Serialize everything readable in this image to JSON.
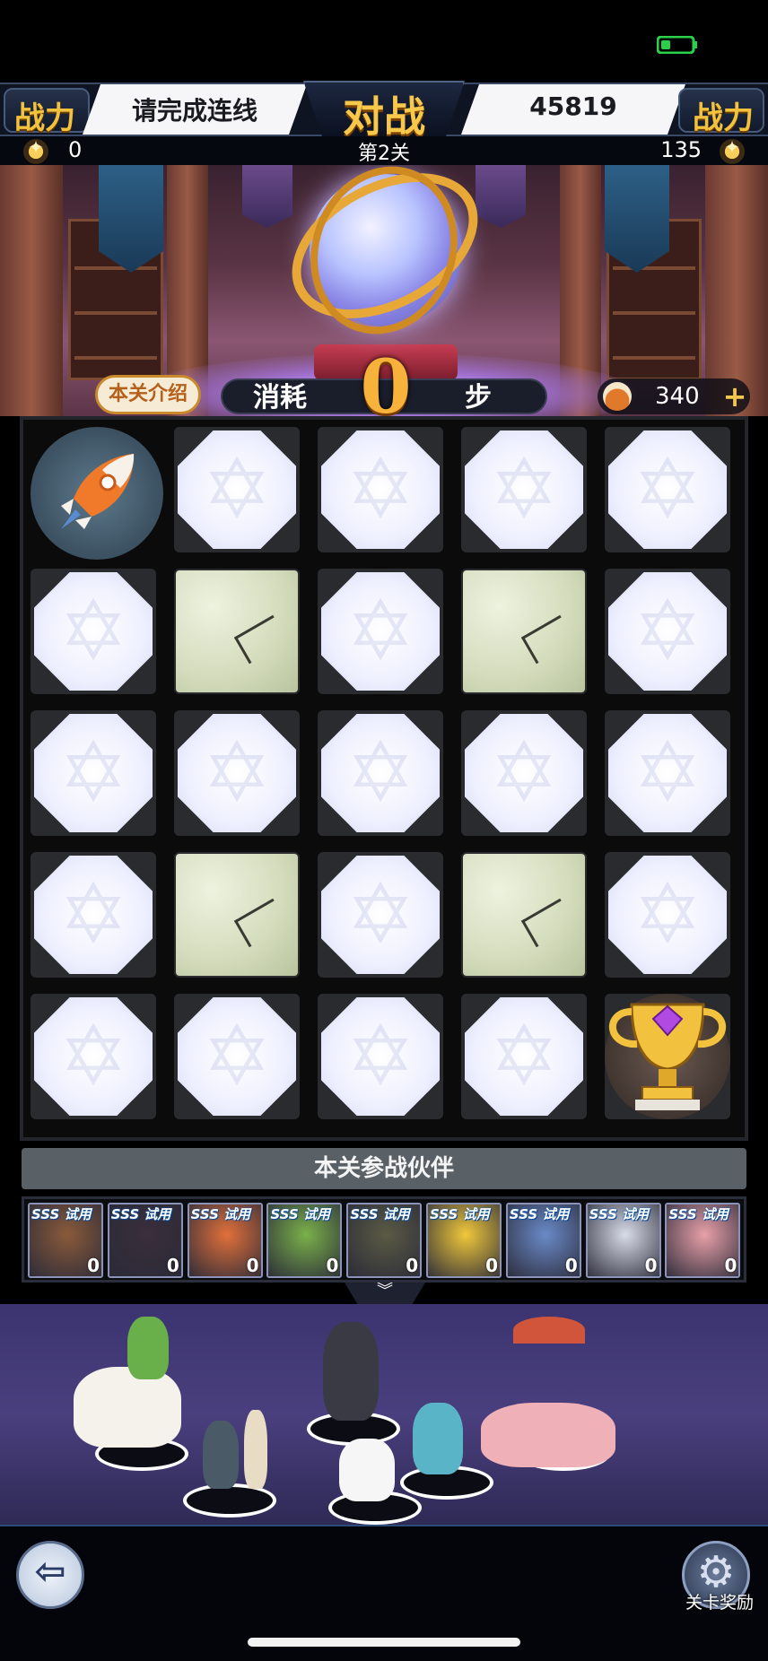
{
  "header": {
    "power_left_label": "战力",
    "power_right_label": "战力",
    "left_banner": "请完成连线",
    "title": "对战",
    "right_banner": "45819",
    "left_stars": "0",
    "level": "第2关",
    "right_stars": "135"
  },
  "controls": {
    "intro_label": "本关介绍",
    "steps_label": "消耗",
    "steps_value": "0",
    "steps_unit": "步",
    "currency_value": "340",
    "plus": "+"
  },
  "board": {
    "rows": 5,
    "cols": 5,
    "layout": [
      [
        "start",
        "hex",
        "hex",
        "hex",
        "hex"
      ],
      [
        "hex",
        "stone",
        "hex",
        "stone",
        "hex"
      ],
      [
        "hex",
        "hex",
        "hex",
        "hex",
        "hex"
      ],
      [
        "hex",
        "stone",
        "hex",
        "stone",
        "hex"
      ],
      [
        "hex",
        "hex",
        "hex",
        "hex",
        "goal"
      ]
    ],
    "start_icon": "rocket-icon",
    "goal_icon": "trophy-icon"
  },
  "partners": {
    "title": "本关参战伙伴",
    "items": [
      {
        "rank": "SSS 试用",
        "count": "0",
        "color": "#8a5a3a"
      },
      {
        "rank": "SSS 试用",
        "count": "0",
        "color": "#3a2e3a"
      },
      {
        "rank": "SSS 试用",
        "count": "0",
        "color": "#e0703a"
      },
      {
        "rank": "SSS 试用",
        "count": "0",
        "color": "#7ab04a"
      },
      {
        "rank": "SSS 试用",
        "count": "0",
        "color": "#5a5a44"
      },
      {
        "rank": "SSS 试用",
        "count": "0",
        "color": "#f0c83a"
      },
      {
        "rank": "SSS 试用",
        "count": "0",
        "color": "#6a8ac8"
      },
      {
        "rank": "SSS 试用",
        "count": "0",
        "color": "#d8dce8"
      },
      {
        "rank": "SSS 试用",
        "count": "0",
        "color": "#e8a0a8"
      }
    ],
    "collapse_icon": "chevron-down-icon"
  },
  "bottom": {
    "exit_icon": "exit-icon",
    "reward_label": "关卡奖励",
    "reward_icon": "gear-icon"
  },
  "colors": {
    "accent_gold": "#f2c23e",
    "board_bg": "#0b0b0c"
  }
}
